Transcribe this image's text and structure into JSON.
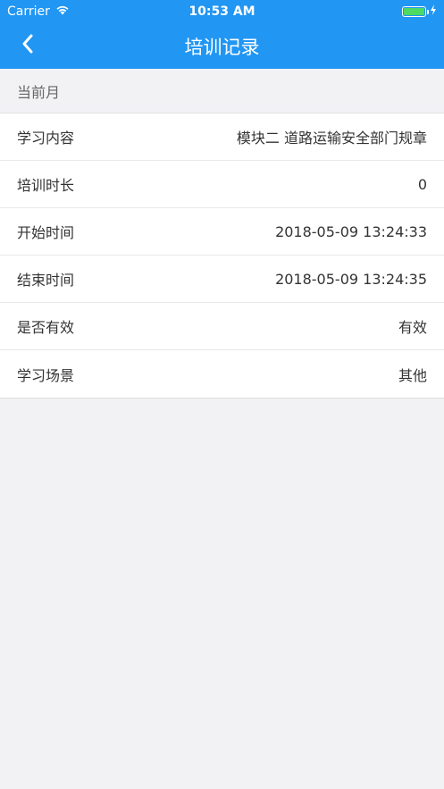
{
  "status_bar": {
    "carrier": "Carrier",
    "time": "10:53 AM",
    "battery_color": "#4cd964"
  },
  "nav": {
    "title": "培训记录",
    "back_icon": "chevron-left-icon"
  },
  "section": {
    "title": "当前月"
  },
  "rows": [
    {
      "label": "学习内容",
      "value": "模块二 道路运输安全部门规章"
    },
    {
      "label": "培训时长",
      "value": "0"
    },
    {
      "label": "开始时间",
      "value": "2018-05-09 13:24:33"
    },
    {
      "label": "结束时间",
      "value": "2018-05-09 13:24:35"
    },
    {
      "label": "是否有效",
      "value": "有效"
    },
    {
      "label": "学习场景",
      "value": "其他"
    }
  ],
  "colors": {
    "accent": "#2196f3",
    "background": "#f2f2f5"
  }
}
